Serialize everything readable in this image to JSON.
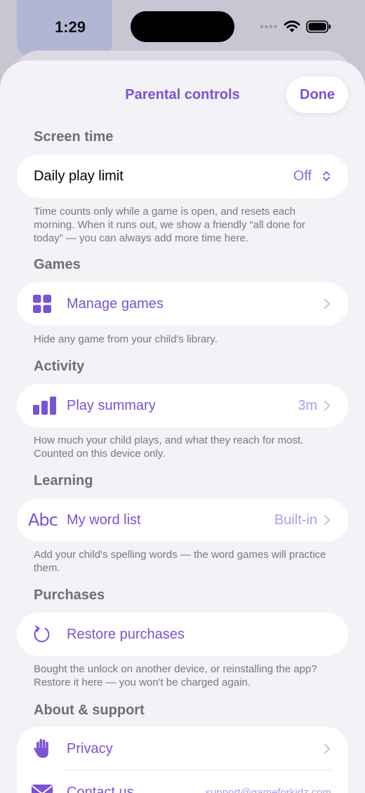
{
  "status": {
    "time": "1:29"
  },
  "header": {
    "title": "Parental controls",
    "done_label": "Done"
  },
  "sections": {
    "screen_time": {
      "title": "Screen time",
      "row_label": "Daily play limit",
      "row_value": "Off",
      "footer": "Time counts only while a game is open, and resets each morning. When it runs out, we show a friendly “all done for today” — you can always add more time here."
    },
    "games": {
      "title": "Games",
      "row_label": "Manage games",
      "footer": "Hide any game from your child's library."
    },
    "activity": {
      "title": "Activity",
      "row_label": "Play summary",
      "row_value": "3m",
      "footer": "How much your child plays, and what they reach for most. Counted on this device only."
    },
    "learning": {
      "title": "Learning",
      "icon_text": "Abc",
      "row_label": "My word list",
      "row_value": "Built-in",
      "footer": "Add your child's spelling words — the word games will practice them."
    },
    "purchases": {
      "title": "Purchases",
      "row_label": "Restore purchases",
      "footer": "Bought the unlock on another device, or reinstalling the app? Restore it here — you won't be charged again."
    },
    "about": {
      "title": "About & support",
      "privacy_label": "Privacy",
      "contact_label": "Contact us",
      "contact_value": "support@gameforkidz.com"
    }
  },
  "colors": {
    "accent": "#7a52d6",
    "accent_light": "#b09be6",
    "background": "#f2f2f7"
  }
}
